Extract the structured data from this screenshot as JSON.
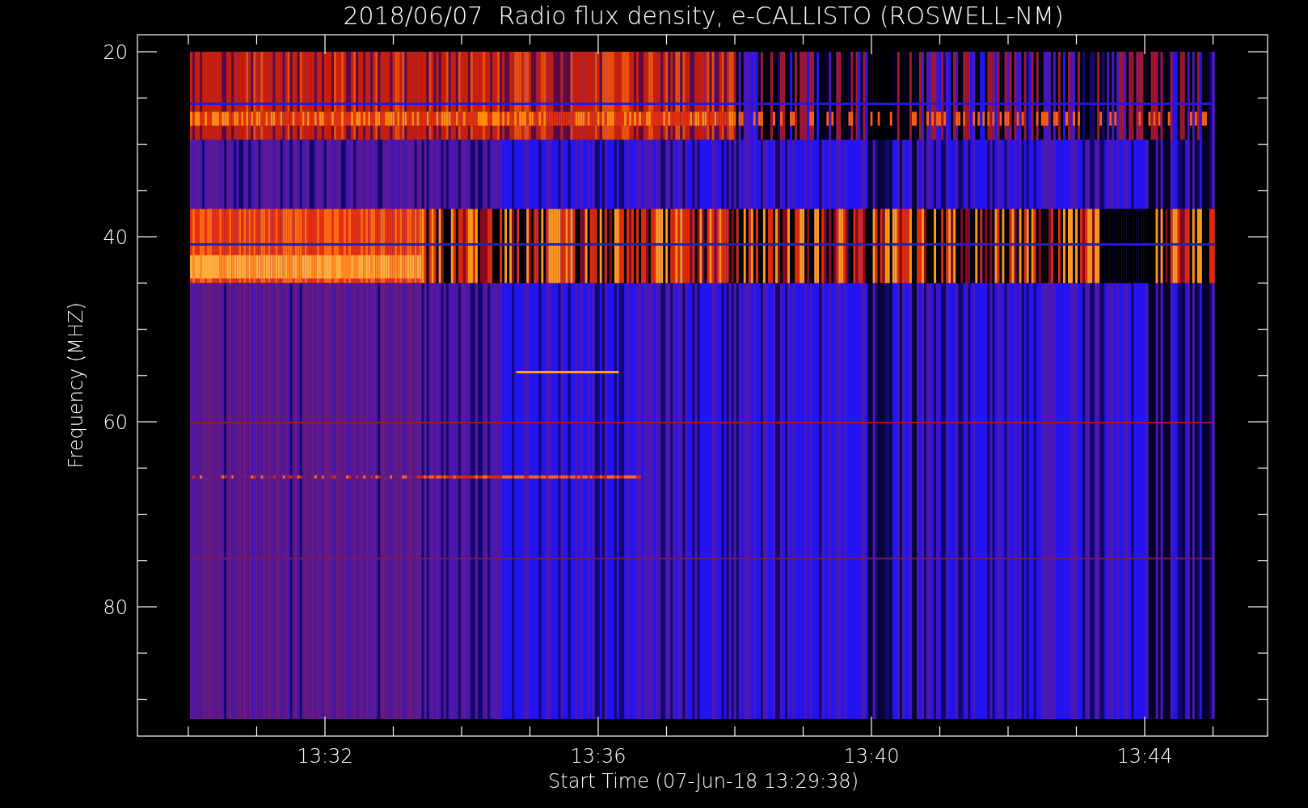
{
  "chart": {
    "title": "2018/06/07  Radio flux density, e-CALLISTO (ROSWELL-NM)",
    "ylabel": "Frequency (MHZ)",
    "xlabel": "Start Time (07-Jun-18 13:29:38)",
    "yticks": [
      "20",
      "40",
      "60",
      "80"
    ],
    "xticks": [
      "13:32",
      "13:36",
      "13:40",
      "13:44"
    ]
  }
}
